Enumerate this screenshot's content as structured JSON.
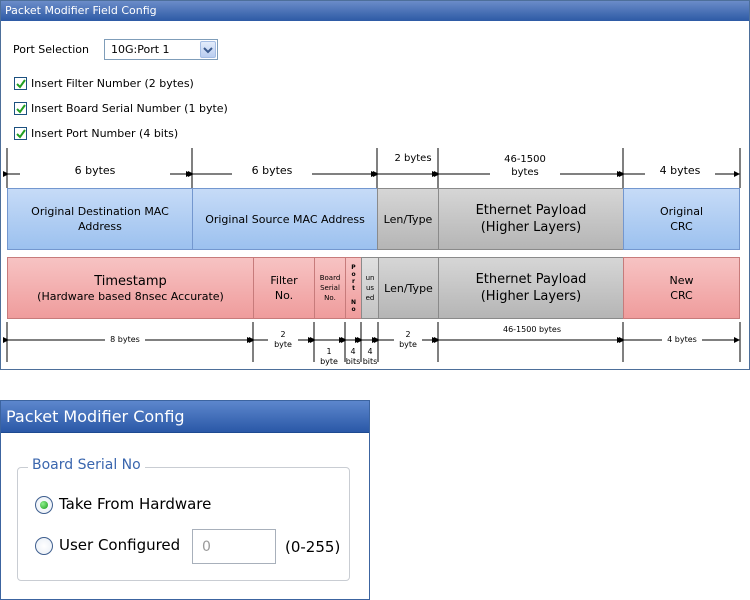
{
  "window1": {
    "title": "Packet Modifier Field Config",
    "port_selection": {
      "label": "Port Selection",
      "value": "10G:Port 1"
    },
    "checkboxes": [
      {
        "label": "Insert Filter Number (2 bytes)",
        "checked": true
      },
      {
        "label": "Insert Board Serial Number (1 byte)",
        "checked": true
      },
      {
        "label": "Insert Port Number (4 bits)",
        "checked": true
      }
    ],
    "diagram": {
      "top_dims": [
        "6 bytes",
        "6 bytes",
        "2 bytes",
        "46-1500\nbytes",
        "4 bytes"
      ],
      "row1": [
        {
          "text": "Original Destination MAC\nAddress"
        },
        {
          "text": "Original Source MAC Address"
        },
        {
          "text": "Len/Type"
        },
        {
          "text": "Ethernet Payload\n(Higher Layers)"
        },
        {
          "text": "Original\nCRC"
        }
      ],
      "row2": [
        {
          "text": "Timestamp",
          "sub": "(Hardware based 8nsec Accurate)"
        },
        {
          "text": "Filter\nNo."
        },
        {
          "text": "Board\nSerial\nNo."
        },
        {
          "text": "P\no\nr\nt\n\nN\no"
        },
        {
          "text": "un\nus\ned"
        },
        {
          "text": "Len/Type"
        },
        {
          "text": "Ethernet Payload\n(Higher Layers)"
        },
        {
          "text": "New\nCRC"
        }
      ],
      "bottom_dims": [
        "8 bytes",
        "2\nbyte",
        "1\nbyte",
        "4\nbits",
        "4\nbits",
        "2\nbyte",
        "46-1500 bytes",
        "4 bytes"
      ]
    }
  },
  "window2": {
    "title": "Packet Modifier Config",
    "group_title": "Board Serial No",
    "radio_hw": {
      "label": "Take From Hardware",
      "selected": true
    },
    "radio_user": {
      "label": "User Configured",
      "selected": false
    },
    "user_value": "0",
    "range_hint": "(0-255)"
  },
  "colors": {
    "title_bar": "#2d5aa5",
    "segment_blue": "#b3cff3",
    "segment_gray": "#c4c4c4",
    "segment_red": "#f2adad",
    "group_title": "#3a66ae"
  }
}
